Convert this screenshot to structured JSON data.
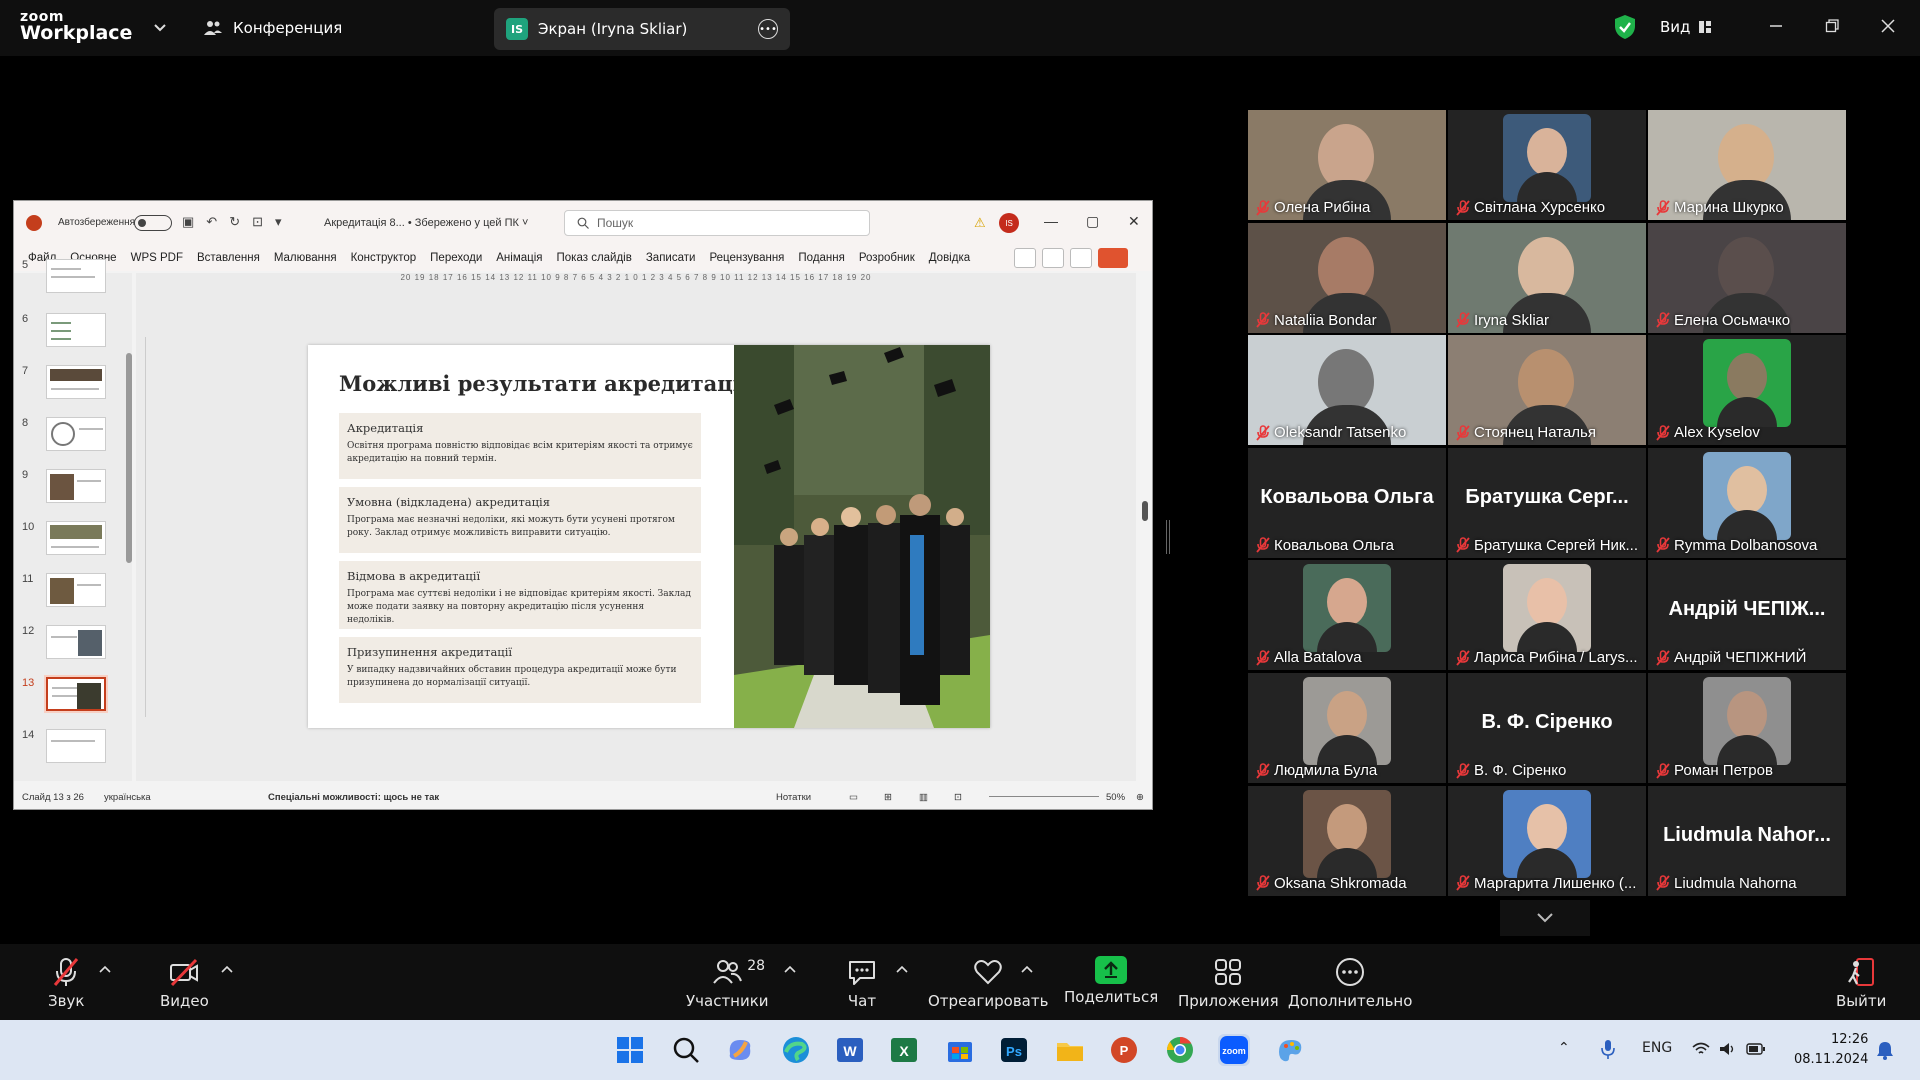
{
  "zoom": {
    "logo_line1": "zoom",
    "logo_line2": "Workplace",
    "meeting_label": "Конференция",
    "screen_badge": "IS",
    "screen_label": "Экран (Iryna Skliar)",
    "view_label": "Вид",
    "colors": {
      "accent_green": "#22d07a",
      "share_green": "#17c04a",
      "mute_red": "#e8383a"
    }
  },
  "ppt": {
    "autosave": "Автозбереження",
    "doc_title": "Акредитація 8...",
    "saved_state": "• Збережено у цей ПК",
    "search_placeholder": "Пошук",
    "user_initials": "IS",
    "menu": [
      "Файл",
      "Основне",
      "WPS PDF",
      "Вставлення",
      "Малювання",
      "Конструктор",
      "Переходи",
      "Анімація",
      "Показ слайдів",
      "Записати",
      "Рецензування",
      "Подання",
      "Розробник",
      "Довідка"
    ],
    "ruler": "20 19 18 17 16 15 14 13 12 11 10 9 8 7 6 5 4 3 2 1 0 1 2 3 4 5 6 7 8 9 10 11 12 13 14 15 16 17 18 19 20",
    "thumb_numbers": [
      "5",
      "6",
      "7",
      "8",
      "9",
      "10",
      "11",
      "12",
      "13",
      "14"
    ],
    "slide": {
      "title": "Можливі результати акредитації",
      "cards": [
        {
          "heading": "Акредитація",
          "text": "Освітня програма повністю відповідає всім критеріям якості та отримує акредитацію на повний термін."
        },
        {
          "heading": "Умовна (відкладена) акредитація",
          "text": "Програма має незначні недоліки, які можуть бути усунені протягом року. Заклад отримує можливість виправити ситуацію."
        },
        {
          "heading": "Відмова в акредитації",
          "text": "Програма має суттєві недоліки і не відповідає критеріям якості. Заклад може подати заявку на повторну акредитацію після усунення недоліків."
        },
        {
          "heading": "Призупинення акредитації",
          "text": "У випадку надзвичайних обставин процедура акредитації може бути призупинена до нормалізації ситуації."
        }
      ]
    },
    "status": {
      "slide_counter": "Слайд 13 з 26",
      "language": "українська",
      "accessibility": "Спеціальні можливості: щось не так",
      "notes": "Нотатки",
      "zoom": "50%"
    }
  },
  "participants": [
    {
      "name": "Олена Рибіна",
      "type": "video",
      "skin": "#c9a48c",
      "bg": "#8a7a66"
    },
    {
      "name": "Світлана Хурсенко",
      "type": "avatar",
      "skin": "#d9b39a",
      "bg": "#3d5a7a"
    },
    {
      "name": "Марина Шкурко",
      "type": "video",
      "skin": "#d5b08c",
      "bg": "#b9b6ad"
    },
    {
      "name": "Nataliia Bondar",
      "type": "video",
      "skin": "#a77b66",
      "bg": "#5d5148"
    },
    {
      "name": "Iryna Skliar",
      "type": "video",
      "skin": "#d8b89e",
      "bg": "#6f7a70",
      "active": true
    },
    {
      "name": "Елена Осьмачко",
      "type": "video",
      "skin": "#5a4e4c",
      "bg": "#4a4446"
    },
    {
      "name": "Oleksandr Tatsenko",
      "type": "video",
      "skin": "#777777",
      "bg": "#c9cfd2"
    },
    {
      "name": "Стоянец Наталья",
      "type": "video",
      "skin": "#b8906f",
      "bg": "#8c7f73"
    },
    {
      "name": "Alex Kyselov",
      "type": "avatar",
      "skin": "#8a7a60",
      "bg": "#29a447"
    },
    {
      "name": "Ковальова Ольга",
      "type": "text",
      "big": "Ковальова Ольга"
    },
    {
      "name": "Братушка Сергей Ник...",
      "type": "text",
      "big": "Братушка Серг..."
    },
    {
      "name": "Rymma Dolbanosova",
      "type": "avatar",
      "skin": "#e0bfa0",
      "bg": "#7fa6c9"
    },
    {
      "name": "Alla Batalova",
      "type": "avatar",
      "skin": "#d6a78e",
      "bg": "#4a6b5a"
    },
    {
      "name": "Лариса Рибіна / Larys...",
      "type": "avatar",
      "skin": "#e8c0a8",
      "bg": "#c8c1b8"
    },
    {
      "name": "Андрій ЧЕПІЖНИЙ",
      "type": "text",
      "big": "Андрій ЧЕПІЖ..."
    },
    {
      "name": "Людмила Була",
      "type": "avatar",
      "skin": "#c9a285",
      "bg": "#9c9a96"
    },
    {
      "name": "В. Ф. Сіренко",
      "type": "text",
      "big": "В. Ф. Сіренко"
    },
    {
      "name": "Роман Петров",
      "type": "avatar",
      "skin": "#b89580",
      "bg": "#8f8f8f"
    },
    {
      "name": "Oksana Shkromada",
      "type": "avatar",
      "skin": "#c49a7c",
      "bg": "#6b5446"
    },
    {
      "name": "Маргарита Лишенко (...",
      "type": "avatar",
      "skin": "#e6c1a8",
      "bg": "#4f7fc2"
    },
    {
      "name": "Liudmula Nahorna",
      "type": "text",
      "big": "Liudmula Nahor..."
    }
  ],
  "toolbar": {
    "audio": "Звук",
    "video": "Видео",
    "participants": "Участники",
    "participants_count": "28",
    "chat": "Чат",
    "react": "Отреагировать",
    "share": "Поделиться",
    "apps": "Приложения",
    "more": "Дополнительно",
    "leave": "Выйти"
  },
  "taskbar": {
    "lang": "ENG",
    "time": "12:26",
    "date": "08.11.2024"
  }
}
